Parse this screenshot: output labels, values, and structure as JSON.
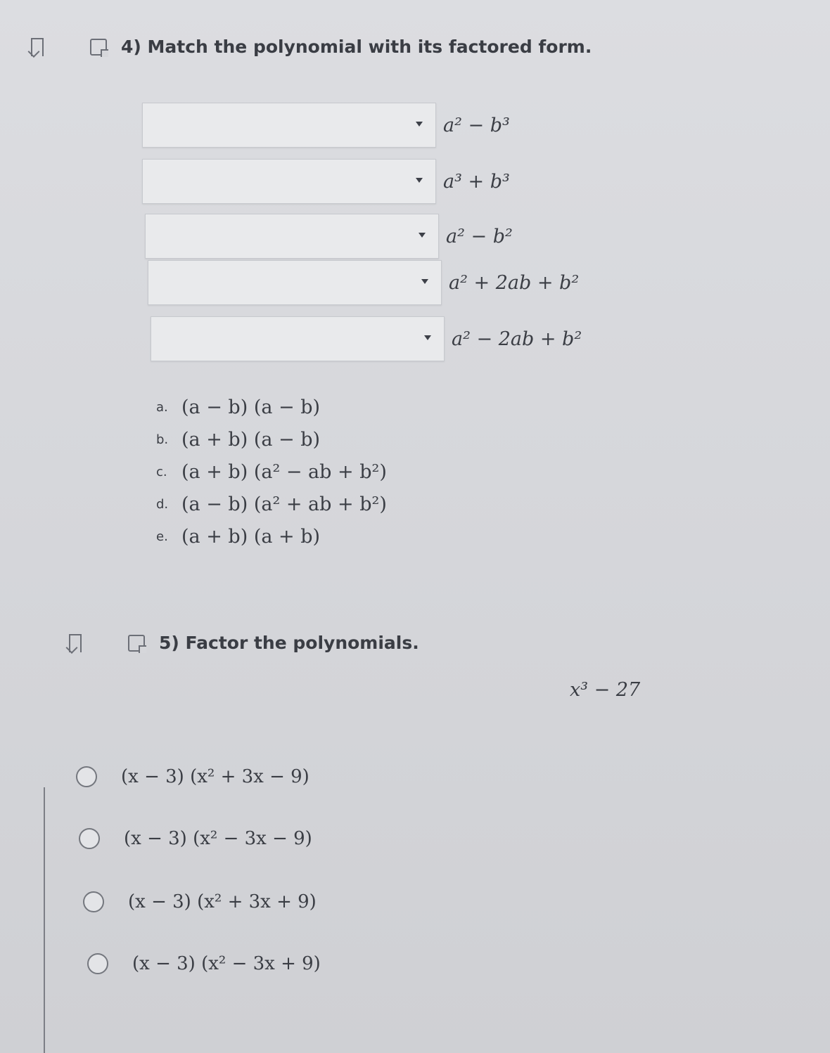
{
  "q4": {
    "title": "4) Match the polynomial with its factored form.",
    "rows": [
      {
        "value": "",
        "polynomial": "a² − b³"
      },
      {
        "value": "",
        "polynomial": "a³ + b³"
      },
      {
        "value": "",
        "polynomial": "a² − b²"
      },
      {
        "value": "",
        "polynomial": "a² + 2ab + b²"
      },
      {
        "value": "",
        "polynomial": "a² − 2ab + b²"
      }
    ],
    "choices": [
      {
        "letter": "a.",
        "text": "(a − b) (a − b)"
      },
      {
        "letter": "b.",
        "text": "(a + b) (a − b)"
      },
      {
        "letter": "c.",
        "text": "(a + b) (a² − ab + b²)"
      },
      {
        "letter": "d.",
        "text": "(a − b) (a² + ab + b²)"
      },
      {
        "letter": "e.",
        "text": "(a + b) (a + b)"
      }
    ]
  },
  "q5": {
    "title": "5) Factor the polynomials.",
    "prompt": "x³ − 27",
    "options": [
      "(x − 3) (x² + 3x − 9)",
      "(x − 3) (x² − 3x − 9)",
      "(x − 3) (x² + 3x + 9)",
      "(x − 3) (x² − 3x + 9)"
    ]
  }
}
